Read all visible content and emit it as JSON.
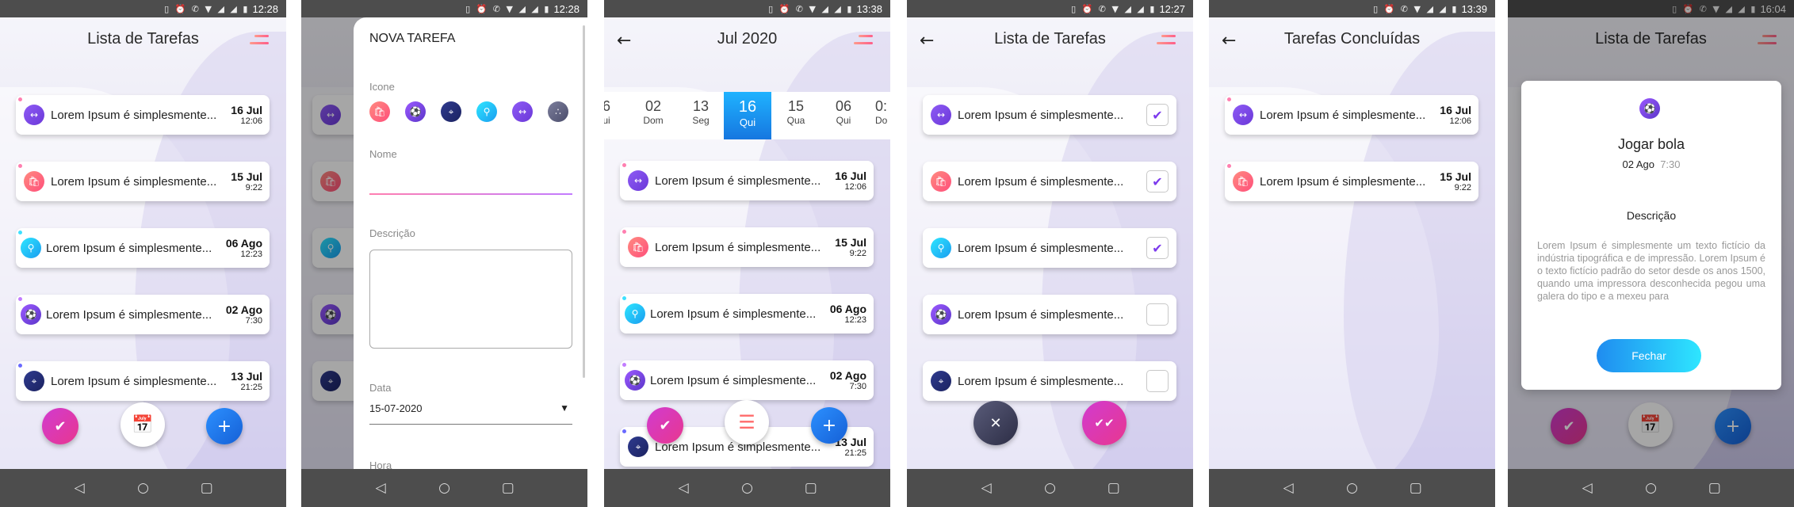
{
  "status": {
    "s1": "12:28",
    "s2": "12:28",
    "s3": "13:38",
    "s4": "12:27",
    "s5": "13:39",
    "s6": "16:04",
    "icons": "▯ ⏰ ✆ ▼ ◢ ◢ ▮"
  },
  "nav": {
    "back": "◁",
    "home": "○",
    "recent": "▢"
  },
  "s1": {
    "title": "Lista de Tarefas",
    "items": [
      {
        "text": "Lorem Ipsum é simplesmente...",
        "date": "16 Jul",
        "time": "12:06",
        "icon": "↔"
      },
      {
        "text": "Lorem Ipsum é simplesmente...",
        "date": "15 Jul",
        "time": "9:22",
        "icon": "🛍"
      },
      {
        "text": "Lorem Ipsum é simplesmente...",
        "date": "06 Ago",
        "time": "12:23",
        "icon": "⚲"
      },
      {
        "text": "Lorem Ipsum é simplesmente...",
        "date": "02 Ago",
        "time": "7:30",
        "icon": "⚽"
      },
      {
        "text": "Lorem Ipsum é simplesmente...",
        "date": "13 Jul",
        "time": "21:25",
        "icon": "⌖"
      }
    ],
    "fab_check": "✔",
    "fab_add": "+"
  },
  "s2": {
    "heading": "NOVA TAREFA",
    "icon_label": "Icone",
    "name_label": "Nome",
    "desc_label": "Descrição",
    "date_label": "Data",
    "date_value": "15-07-2020",
    "time_label": "Hora"
  },
  "s3": {
    "title": "Jul 2020",
    "days": [
      {
        "n": "6",
        "w": "ui"
      },
      {
        "n": "02",
        "w": "Dom"
      },
      {
        "n": "13",
        "w": "Seg"
      },
      {
        "n": "16",
        "w": "Qui"
      },
      {
        "n": "15",
        "w": "Qua"
      },
      {
        "n": "06",
        "w": "Qui"
      },
      {
        "n": "0:",
        "w": "Do"
      }
    ]
  },
  "s4": {
    "title": "Lista de Tarefas",
    "close": "✕",
    "confirm": "✔✔"
  },
  "s5": {
    "title": "Tarefas Concluídas"
  },
  "s6": {
    "title": "Lista de Tarefas",
    "dlg_title": "Jogar bola",
    "dlg_date": "02 Ago",
    "dlg_time": "7:30",
    "desc_label": "Descrição",
    "desc": "Lorem Ipsum é simplesmente um texto fictício da indústria tipográfica e de impressão. Lorem Ipsum é o texto fictício padrão do setor desde os anos 1500, quando uma impressora desconhecida pegou uma galera do tipo e a mexeu para",
    "close_btn": "Fechar"
  },
  "colors": {
    "accent": "#ff4f7b",
    "purple": "#7c3aed"
  }
}
